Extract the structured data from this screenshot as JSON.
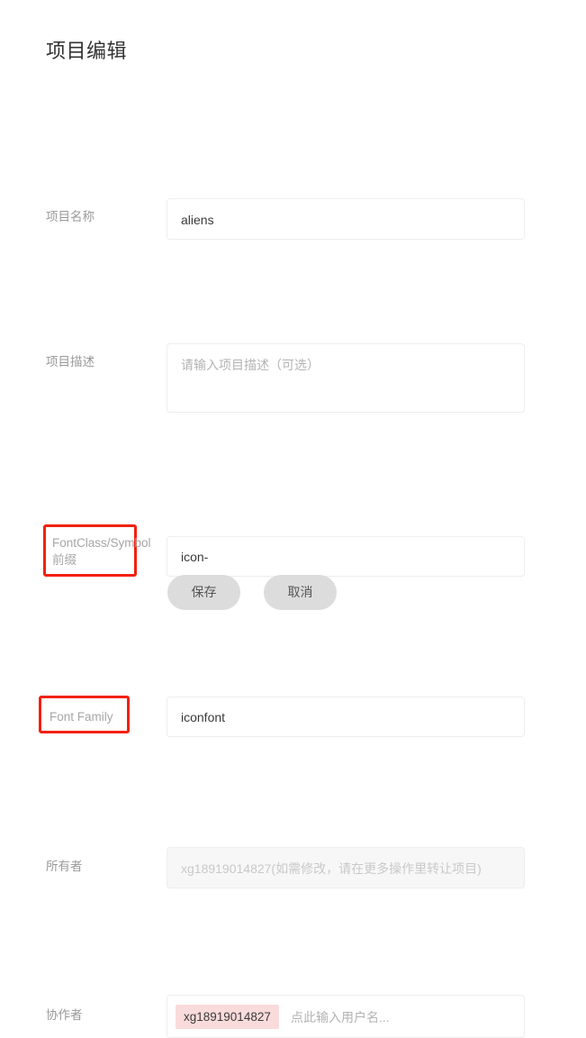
{
  "page": {
    "title": "项目编辑"
  },
  "fields": {
    "name": {
      "label": "项目名称",
      "value": "aliens"
    },
    "description": {
      "label": "项目描述",
      "placeholder": "请输入项目描述（可选）"
    },
    "prefix": {
      "label": "FontClass/Symbol 前缀",
      "value": "icon-",
      "highlight_color": "#f2210f",
      "highlighted": true
    },
    "font_family": {
      "label": "Font Family",
      "value": "iconfont",
      "highlight_color": "#f2210f",
      "highlighted": true
    },
    "owner": {
      "label": "所有者",
      "placeholder": "xg18919014827(如需修改，请在更多操作里转让项目)",
      "disabled": true
    },
    "collaborators": {
      "label": "协作者",
      "tags": [
        "xg18919014827"
      ],
      "placeholder": "点此输入用户名...",
      "tag_bg_color": "#fadbdb"
    }
  },
  "buttons": {
    "save": "保存",
    "cancel": "取消"
  }
}
